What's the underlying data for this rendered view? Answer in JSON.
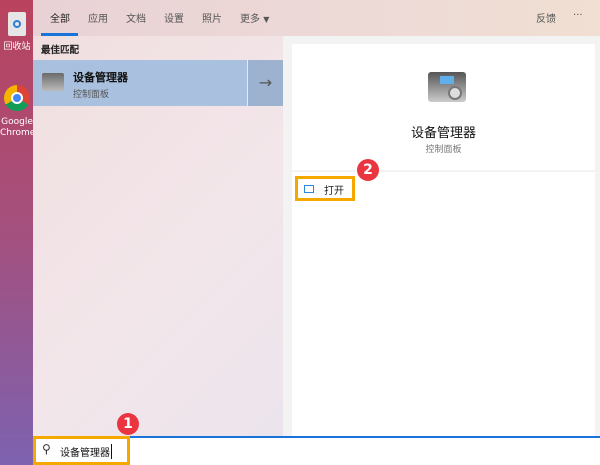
{
  "desktop": {
    "recycle_bin": "回收站",
    "chrome": "Google Chrome"
  },
  "tabs": [
    {
      "label": "全部"
    },
    {
      "label": "应用"
    },
    {
      "label": "文档"
    },
    {
      "label": "设置"
    },
    {
      "label": "照片"
    },
    {
      "label": "更多"
    }
  ],
  "header_right": {
    "feedback": "反馈",
    "more": "···"
  },
  "best_match": {
    "heading": "最佳匹配",
    "title": "设备管理器",
    "subtitle": "控制面板"
  },
  "detail": {
    "title": "设备管理器",
    "subtitle": "控制面板",
    "open_label": "打开"
  },
  "search": {
    "value": "设备管理器"
  },
  "badges": {
    "one": "1",
    "two": "2"
  },
  "colors": {
    "accent": "#1a73d9",
    "highlight": "#f5a800",
    "badge": "#ea3540"
  }
}
